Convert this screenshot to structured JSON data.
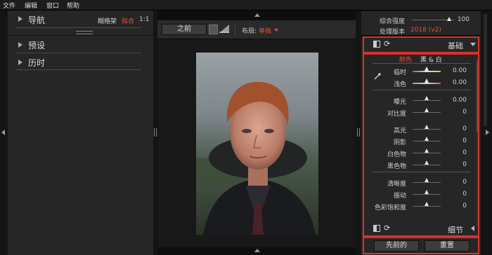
{
  "menu": [
    "文件",
    "编辑",
    "窗口",
    "帮助"
  ],
  "left_panel": {
    "navigator": {
      "label": "导航",
      "fit_label": "糊格架",
      "fill_label": "拟合",
      "ratio_label": "1:1"
    },
    "sections": [
      "预设",
      "历时"
    ]
  },
  "toolbar": {
    "before_button": "之前",
    "layout_label": "布局:",
    "layout_value": "单独"
  },
  "right_top": {
    "rows": [
      {
        "label": "综合强度",
        "value": "100",
        "level": 0.88
      },
      {
        "label": "处理版本",
        "value": "2018 (v2)"
      }
    ]
  },
  "basic_panel": {
    "title": "基础",
    "tab_color": "颜色",
    "tab_bw": "黑 & 白",
    "sliders": [
      {
        "label": "临时",
        "value": "0.00",
        "level": 0.5,
        "gradient": "temp"
      },
      {
        "label": "浅色",
        "value": "0.00",
        "level": 0.5,
        "gradient": "tint"
      },
      {
        "label": "曝光",
        "value": "0.00",
        "level": 0.5
      },
      {
        "label": "对比度",
        "value": "0",
        "level": 0.5
      },
      {
        "label": "高光",
        "value": "0",
        "level": 0.5
      },
      {
        "label": "阴影",
        "value": "0",
        "level": 0.5
      },
      {
        "label": "白色物",
        "value": "0",
        "level": 0.5
      },
      {
        "label": "黑色物",
        "value": "0",
        "level": 0.5
      },
      {
        "label": "清晰度",
        "value": "0",
        "level": 0.5
      },
      {
        "label": "振动",
        "value": "0",
        "level": 0.5
      },
      {
        "label": "色彩饱和度",
        "value": "0",
        "level": 0.5
      }
    ],
    "detail_title": "细节",
    "prev_button": "先前的",
    "reset_button": "重置"
  },
  "colors": {
    "accent": "#e2523a",
    "highlight": "#d9312b",
    "panel": "#262626"
  }
}
